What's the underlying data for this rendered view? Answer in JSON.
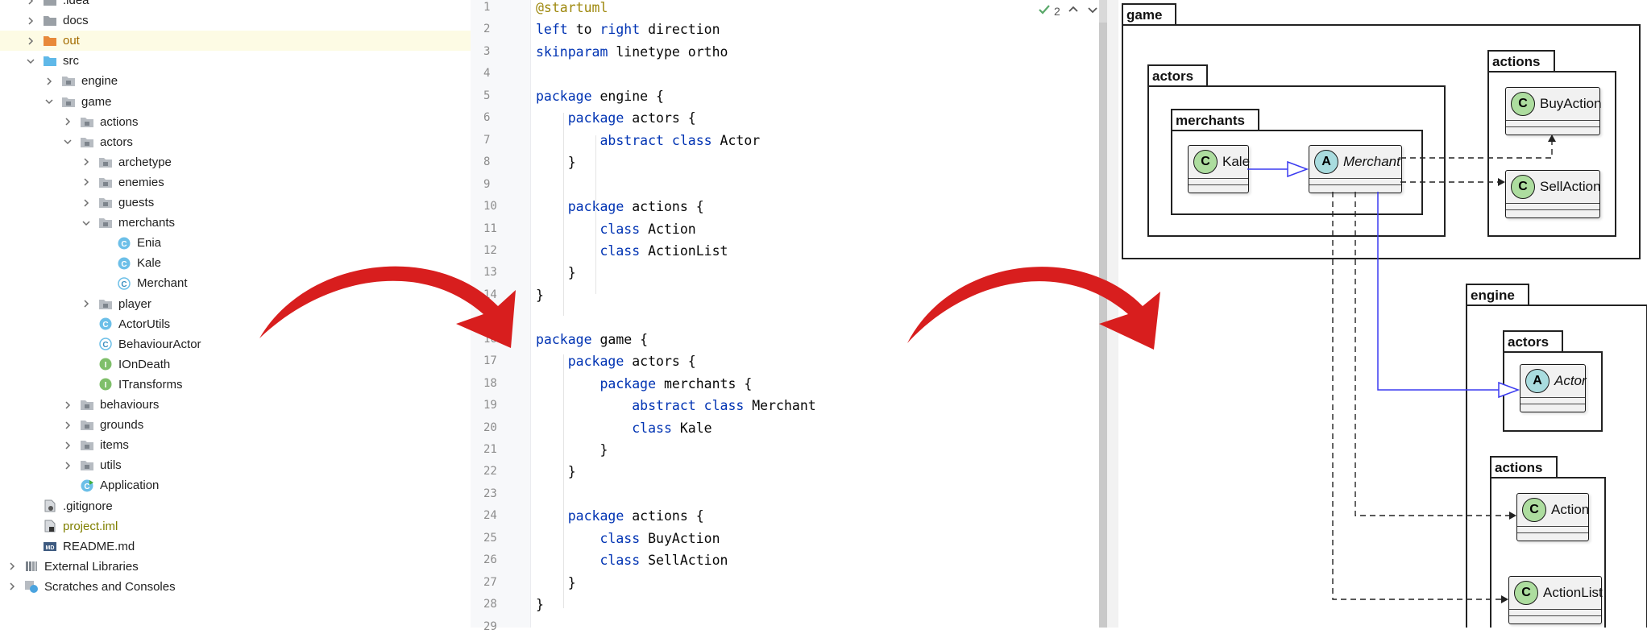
{
  "project_tree": {
    "items": [
      {
        "label": ".idea"
      },
      {
        "label": "docs"
      },
      {
        "label": "out"
      },
      {
        "label": "src"
      },
      {
        "label": "engine"
      },
      {
        "label": "game"
      },
      {
        "label": "actions"
      },
      {
        "label": "actors"
      },
      {
        "label": "archetype"
      },
      {
        "label": "enemies"
      },
      {
        "label": "guests"
      },
      {
        "label": "merchants"
      },
      {
        "label": "Enia"
      },
      {
        "label": "Kale"
      },
      {
        "label": "Merchant"
      },
      {
        "label": "player"
      },
      {
        "label": "ActorUtils"
      },
      {
        "label": "BehaviourActor"
      },
      {
        "label": "IOnDeath"
      },
      {
        "label": "ITransforms"
      },
      {
        "label": "behaviours"
      },
      {
        "label": "grounds"
      },
      {
        "label": "items"
      },
      {
        "label": "utils"
      },
      {
        "label": "Application"
      },
      {
        "label": ".gitignore"
      },
      {
        "label": "project.iml"
      },
      {
        "label": "README.md"
      },
      {
        "label": "External Libraries"
      },
      {
        "label": "Scratches and Consoles"
      }
    ]
  },
  "editor": {
    "inspection_count": "2",
    "lines": [
      {
        "n": "1",
        "t": "@startuml"
      },
      {
        "n": "2",
        "t": "left to right direction"
      },
      {
        "n": "3",
        "t": "skinparam linetype ortho"
      },
      {
        "n": "4",
        "t": ""
      },
      {
        "n": "5",
        "t": "package engine {"
      },
      {
        "n": "6",
        "t": "    package actors {"
      },
      {
        "n": "7",
        "t": "        abstract class Actor"
      },
      {
        "n": "8",
        "t": "    }"
      },
      {
        "n": "9",
        "t": ""
      },
      {
        "n": "10",
        "t": "    package actions {"
      },
      {
        "n": "11",
        "t": "        class Action"
      },
      {
        "n": "12",
        "t": "        class ActionList"
      },
      {
        "n": "13",
        "t": "    }"
      },
      {
        "n": "14",
        "t": "}"
      },
      {
        "n": "15",
        "t": ""
      },
      {
        "n": "16",
        "t": "package game {"
      },
      {
        "n": "17",
        "t": "    package actors {"
      },
      {
        "n": "18",
        "t": "        package merchants {"
      },
      {
        "n": "19",
        "t": "            abstract class Merchant"
      },
      {
        "n": "20",
        "t": "            class Kale"
      },
      {
        "n": "21",
        "t": "        }"
      },
      {
        "n": "22",
        "t": "    }"
      },
      {
        "n": "23",
        "t": ""
      },
      {
        "n": "24",
        "t": "    package actions {"
      },
      {
        "n": "25",
        "t": "        class BuyAction"
      },
      {
        "n": "26",
        "t": "        class SellAction"
      },
      {
        "n": "27",
        "t": "    }"
      },
      {
        "n": "28",
        "t": "}"
      },
      {
        "n": "29",
        "t": ""
      }
    ]
  },
  "diagram": {
    "packages": {
      "game": "game",
      "game_actors": "actors",
      "merchants": "merchants",
      "game_actions": "actions",
      "engine": "engine",
      "engine_actors": "actors",
      "engine_actions": "actions"
    },
    "classes": {
      "kale": {
        "badge": "C",
        "name": "Kale"
      },
      "merchant": {
        "badge": "A",
        "name": "Merchant"
      },
      "buy_action": {
        "badge": "C",
        "name": "BuyAction"
      },
      "sell_action": {
        "badge": "C",
        "name": "SellAction"
      },
      "actor": {
        "badge": "A",
        "name": "Actor"
      },
      "action": {
        "badge": "C",
        "name": "Action"
      },
      "action_list": {
        "badge": "C",
        "name": "ActionList"
      }
    }
  },
  "colors": {
    "keyword": "#0033b3",
    "directive": "#9e880d",
    "inheritance_arrow": "#3b3bf0",
    "guide_arrow": "#d81e1e",
    "class_badge": "#addd9f",
    "abstract_badge": "#a9dcdf"
  }
}
